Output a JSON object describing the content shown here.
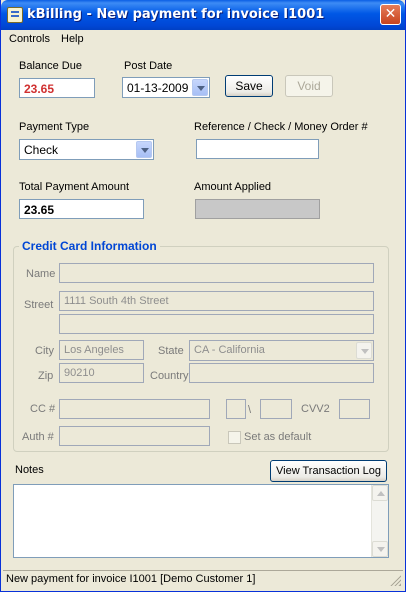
{
  "window": {
    "title": "kBilling - New payment for invoice I1001",
    "close_glyph": "✕"
  },
  "menu": {
    "controls": "Controls",
    "help": "Help"
  },
  "payment": {
    "balance_due_label": "Balance Due",
    "balance_due_value": "23.65",
    "post_date_label": "Post Date",
    "post_date_value": "01-13-2009",
    "save_label": "Save",
    "void_label": "Void",
    "payment_type_label": "Payment Type",
    "payment_type_value": "Check",
    "reference_label": "Reference / Check / Money Order #",
    "reference_value": "",
    "total_payment_label": "Total Payment Amount",
    "total_payment_value": "23.65",
    "amount_applied_label": "Amount Applied",
    "amount_applied_value": ""
  },
  "credit_card": {
    "group_title": "Credit Card Information",
    "name_label": "Name",
    "name_value": "",
    "street_label": "Street",
    "street1_value": "1111 South 4th Street",
    "street2_value": "",
    "city_label": "City",
    "city_value": "Los Angeles",
    "state_label": "State",
    "state_value": "CA - California",
    "zip_label": "Zip",
    "zip_value": "90210",
    "country_label": "Country",
    "country_value": "",
    "cc_label": "CC #",
    "cc_value": "",
    "exp_month_value": "",
    "exp_separator": "\\",
    "exp_year_value": "",
    "cvv2_label": "CVV2",
    "cvv2_value": "",
    "auth_label": "Auth #",
    "auth_value": "",
    "set_default_label": "Set as default"
  },
  "notes": {
    "label": "Notes",
    "view_log_label": "View Transaction Log",
    "value": ""
  },
  "status": {
    "text": "New payment for invoice I1001 [Demo Customer 1]"
  },
  "colors": {
    "titlebar": "#0058e6",
    "window_bg": "#ece9d8",
    "balance_due": "#d03030",
    "group_title": "#0046d5"
  },
  "icons": {
    "app": "app-ledger-icon",
    "close": "close-icon",
    "dropdown": "chevron-down-icon"
  }
}
